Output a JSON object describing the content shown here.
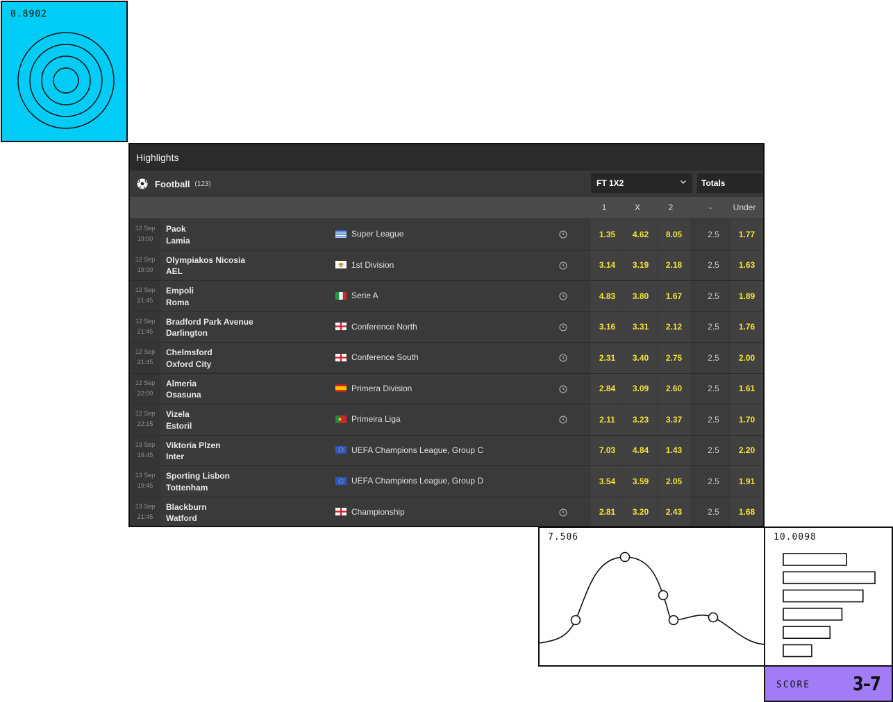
{
  "cyan_widget": {
    "value": "0.8902"
  },
  "panel": {
    "title": "Highlights",
    "sport": {
      "name": "Football",
      "count": "(123)",
      "icon": "soccer-ball-icon"
    },
    "market_select": {
      "value": "FT 1X2"
    },
    "totals_select": {
      "value": "Totals"
    },
    "columns": {
      "c1": "1",
      "cx": "X",
      "c2": "2",
      "dash": "-",
      "under": "Under"
    },
    "matches": [
      {
        "date": "12 Sep",
        "time": "19:00",
        "home": "Paok",
        "away": "Lamia",
        "flag": "greece",
        "league": "Super League",
        "clock": true,
        "o1": "1.35",
        "ox": "4.62",
        "o2": "8.05",
        "line": "2.5",
        "under": "1.77"
      },
      {
        "date": "12 Sep",
        "time": "19:00",
        "home": "Olympiakos Nicosia",
        "away": "AEL",
        "flag": "cyprus",
        "league": "1st Division",
        "clock": true,
        "o1": "3.14",
        "ox": "3.19",
        "o2": "2.18",
        "line": "2.5",
        "under": "1.63"
      },
      {
        "date": "12 Sep",
        "time": "21:45",
        "home": "Empoli",
        "away": "Roma",
        "flag": "italy",
        "league": "Serie A",
        "clock": true,
        "o1": "4.83",
        "ox": "3.80",
        "o2": "1.67",
        "line": "2.5",
        "under": "1.89"
      },
      {
        "date": "12 Sep",
        "time": "21:45",
        "home": "Bradford Park Avenue",
        "away": "Darlington",
        "flag": "england",
        "league": "Conference North",
        "clock": true,
        "o1": "3.16",
        "ox": "3.31",
        "o2": "2.12",
        "line": "2.5",
        "under": "1.76"
      },
      {
        "date": "12 Sep",
        "time": "21:45",
        "home": "Chelmsford",
        "away": "Oxford City",
        "flag": "england",
        "league": "Conference South",
        "clock": true,
        "o1": "2.31",
        "ox": "3.40",
        "o2": "2.75",
        "line": "2.5",
        "under": "2.00"
      },
      {
        "date": "12 Sep",
        "time": "22:00",
        "home": "Almeria",
        "away": "Osasuna",
        "flag": "spain",
        "league": "Primera Division",
        "clock": true,
        "o1": "2.84",
        "ox": "3.09",
        "o2": "2.60",
        "line": "2.5",
        "under": "1.61"
      },
      {
        "date": "12 Sep",
        "time": "22:15",
        "home": "Vizela",
        "away": "Estoril",
        "flag": "portugal",
        "league": "Primeira Liga",
        "clock": true,
        "o1": "2.11",
        "ox": "3.23",
        "o2": "3.37",
        "line": "2.5",
        "under": "1.70"
      },
      {
        "date": "13 Sep",
        "time": "19:45",
        "home": "Viktoria Plzen",
        "away": "Inter",
        "flag": "europe",
        "league": "UEFA Champions League, Group C",
        "clock": false,
        "o1": "7.03",
        "ox": "4.84",
        "o2": "1.43",
        "line": "2.5",
        "under": "2.20"
      },
      {
        "date": "13 Sep",
        "time": "19:45",
        "home": "Sporting Lisbon",
        "away": "Tottenham",
        "flag": "europe",
        "league": "UEFA Champions League, Group D",
        "clock": false,
        "o1": "3.54",
        "ox": "3.59",
        "o2": "2.05",
        "line": "2.5",
        "under": "1.91"
      },
      {
        "date": "13 Sep",
        "time": "21:45",
        "home": "Blackburn",
        "away": "Watford",
        "flag": "england",
        "league": "Championship",
        "clock": true,
        "o1": "2.81",
        "ox": "3.20",
        "o2": "2.43",
        "line": "2.5",
        "under": "1.68"
      }
    ]
  },
  "line_widget": {
    "value": "7.506"
  },
  "bar_widget": {
    "value": "10.0098",
    "bar_values": [
      0.69,
      1.0,
      0.87,
      0.64,
      0.51,
      0.31
    ]
  },
  "score_widget": {
    "label": "SCORE",
    "value": "3–7"
  },
  "colors": {
    "cyan": "#00ccf5",
    "odds_yellow": "#f2e23a",
    "score_purple": "#a27cf7",
    "panel_bg": "#3a3a3a"
  }
}
